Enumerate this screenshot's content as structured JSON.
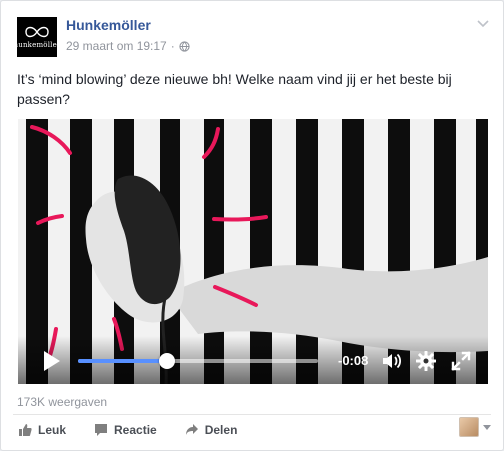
{
  "post": {
    "page_name": "Hunkemöller",
    "timestamp": "29 maart om 19:17",
    "separator": "·",
    "privacy_icon": "globe-icon",
    "text": "It’s ‘mind blowing’ deze nieuwe bh! Welke naam vind jij er het beste bij passen?",
    "avatar_text": "hunkemöller"
  },
  "video": {
    "time_remaining": "-0:08",
    "progress": 0.37,
    "icons": [
      "play-icon",
      "volume-icon",
      "settings-gear-icon",
      "fullscreen-icon"
    ],
    "accent_color": "#5890ff",
    "stroke_color": "#e8185a"
  },
  "stats": {
    "views": "173K weergaven"
  },
  "actions": {
    "like": "Leuk",
    "comment": "Reactie",
    "share": "Delen"
  },
  "colors": {
    "link": "#365899",
    "meta": "#90949c",
    "action": "#4b4f56"
  }
}
